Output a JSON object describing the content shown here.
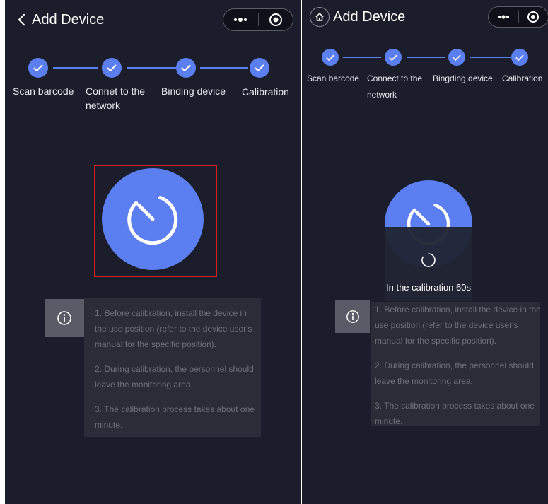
{
  "left": {
    "title": "Add Device",
    "steps": [
      "Scan barcode",
      "Connet to the\nnetwork",
      "Binding device",
      "Calibration"
    ],
    "instructions": [
      "1. Before calibration, install the device in the use position (refer to the device user's manual for the specific position).",
      "2. During calibration, the personnel should leave the monitoring area.",
      "3. The calibration process takes about one minute."
    ]
  },
  "right": {
    "title": "Add Device",
    "steps": [
      "Scan barcode",
      "Connect to the\nnetwork",
      "Bingding device",
      "Calibration"
    ],
    "toast": "In the calibration 60s",
    "instructions": [
      "1. Before calibration, install the device in the use position (refer to the device user's manual for the specific position).",
      "2. During calibration, the personnel should leave the monitoring area.",
      "3. The calibration process takes about one minute."
    ]
  },
  "icons": {
    "back": "chevron-left-icon",
    "home": "home-icon",
    "more": "more-dots-icon",
    "close": "target-icon",
    "step_done": "checkmark-icon",
    "calibrate": "timer-icon",
    "info": "info-icon",
    "loading": "spinner-icon"
  },
  "colors": {
    "background": "#1b1d2b",
    "accent": "#5b7ff0",
    "card": "#2a2c38",
    "highlight_border": "#d42020"
  }
}
